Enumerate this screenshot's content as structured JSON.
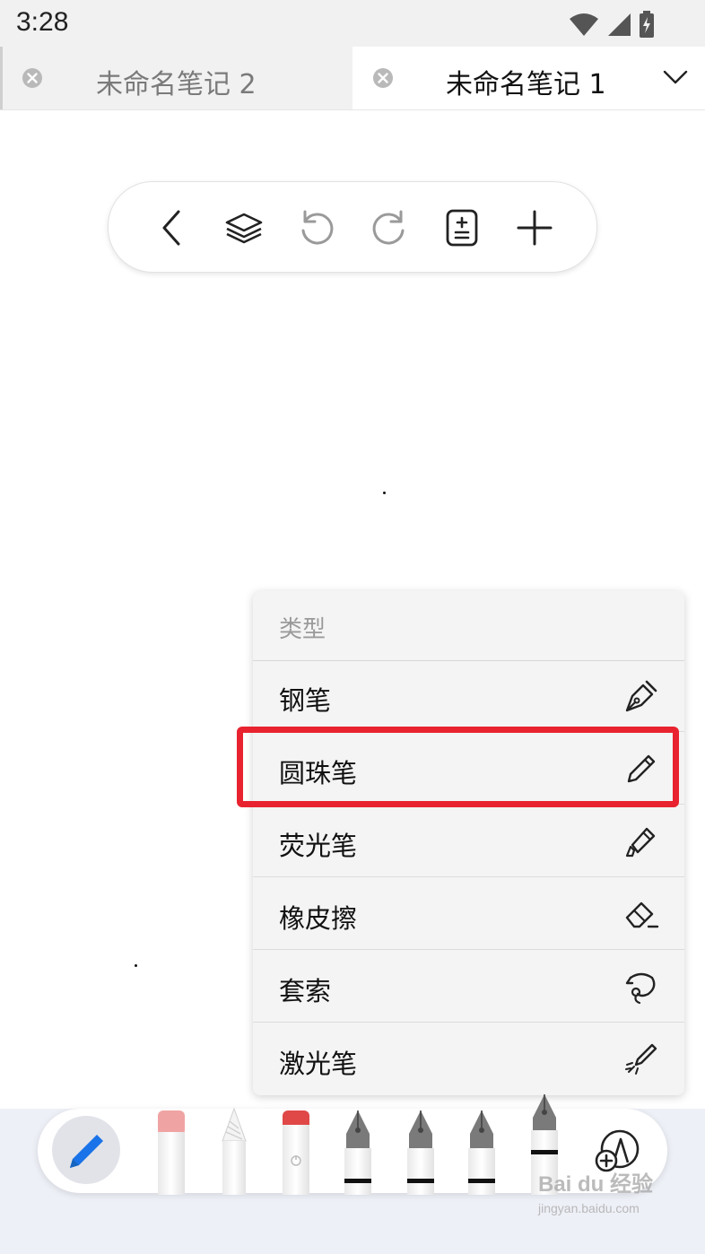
{
  "status": {
    "time": "3:28"
  },
  "tabs": [
    {
      "label": "未命名笔记 2",
      "active": false
    },
    {
      "label": "未命名笔记 1",
      "active": true
    }
  ],
  "toolbar": {
    "buttons": [
      "back-icon",
      "layers-icon",
      "undo-icon",
      "redo-icon",
      "page-add-icon",
      "plus-icon"
    ]
  },
  "menu": {
    "header": "类型",
    "items": [
      {
        "label": "钢笔",
        "icon": "fountain-pen-icon"
      },
      {
        "label": "圆珠笔",
        "icon": "ballpoint-pen-icon"
      },
      {
        "label": "荧光笔",
        "icon": "highlighter-icon"
      },
      {
        "label": "橡皮擦",
        "icon": "eraser-icon"
      },
      {
        "label": "套索",
        "icon": "lasso-icon"
      },
      {
        "label": "激光笔",
        "icon": "laser-pointer-icon"
      }
    ],
    "highlighted_index": 1
  },
  "pen_tray": {
    "tools": [
      "ballpoint-pen-active",
      "marker-pink",
      "pencil",
      "highlighter-red",
      "fountain-pen-1",
      "fountain-pen-2",
      "fountain-pen-3",
      "fountain-pen-4",
      "add-pen-icon"
    ]
  },
  "colors": {
    "highlight": "#e8232f",
    "active_pen": "#1a73e8"
  },
  "watermark": {
    "brand": "Bai du 经验",
    "url": "jingyan.baidu.com"
  }
}
